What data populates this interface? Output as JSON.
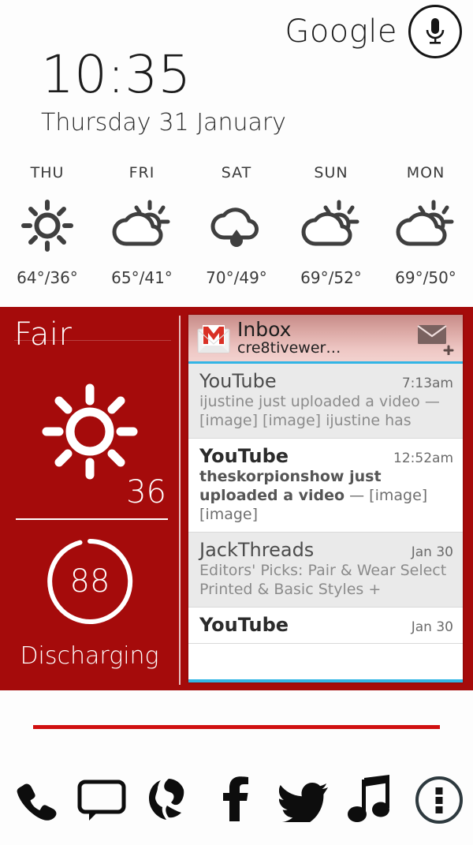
{
  "search": {
    "brand": "Google",
    "mic_icon": "microphone-icon"
  },
  "clock": {
    "time": "10:35",
    "day_of_week": "Thursday",
    "date": "31 January"
  },
  "forecast": {
    "days": [
      {
        "label": "THU",
        "icon": "sunny-icon",
        "temps": "64°/36°"
      },
      {
        "label": "FRI",
        "icon": "partly-cloudy-icon",
        "temps": "65°/41°"
      },
      {
        "label": "SAT",
        "icon": "rain-icon",
        "temps": "70°/49°"
      },
      {
        "label": "SUN",
        "icon": "partly-cloudy-icon",
        "temps": "69°/52°"
      },
      {
        "label": "MON",
        "icon": "partly-cloudy-icon",
        "temps": "69°/50°"
      }
    ]
  },
  "weather_widget": {
    "condition": "Fair",
    "icon": "sunny-icon",
    "temperature": "36",
    "accent_color": "#a50b0b"
  },
  "battery_widget": {
    "percent": "88",
    "percent_value": 88,
    "status": "Discharging"
  },
  "gmail": {
    "logo_icon": "gmail-logo-icon",
    "title": "Inbox",
    "account": "cre8tivewer…",
    "compose_icon": "compose-mail-icon",
    "accent_color": "#33b5e5",
    "messages": [
      {
        "sender": "YouTube",
        "time": "7:13am",
        "snippet": "ijustine just uploaded a video — [image] [image] ijustine has",
        "unread": false
      },
      {
        "sender": "YouTube",
        "time": "12:52am",
        "snippet_bold": "theskorpionshow just uploaded a video",
        "snippet_plain": " — [image] [image]",
        "unread": true
      },
      {
        "sender": "JackThreads",
        "time": "Jan 30",
        "snippet": "Editors' Picks: Pair & Wear Select Printed & Basic Styles +",
        "unread": false
      },
      {
        "sender": "YouTube",
        "time": "Jan 30",
        "snippet": "",
        "unread": true
      }
    ]
  },
  "dock": {
    "items": [
      {
        "name": "phone-icon",
        "label": "Phone"
      },
      {
        "name": "messaging-icon",
        "label": "Messaging"
      },
      {
        "name": "browser-icon",
        "label": "Browser"
      },
      {
        "name": "facebook-icon",
        "label": "Facebook"
      },
      {
        "name": "twitter-icon",
        "label": "Twitter"
      },
      {
        "name": "music-icon",
        "label": "Music"
      },
      {
        "name": "app-drawer-icon",
        "label": "Apps"
      }
    ]
  }
}
